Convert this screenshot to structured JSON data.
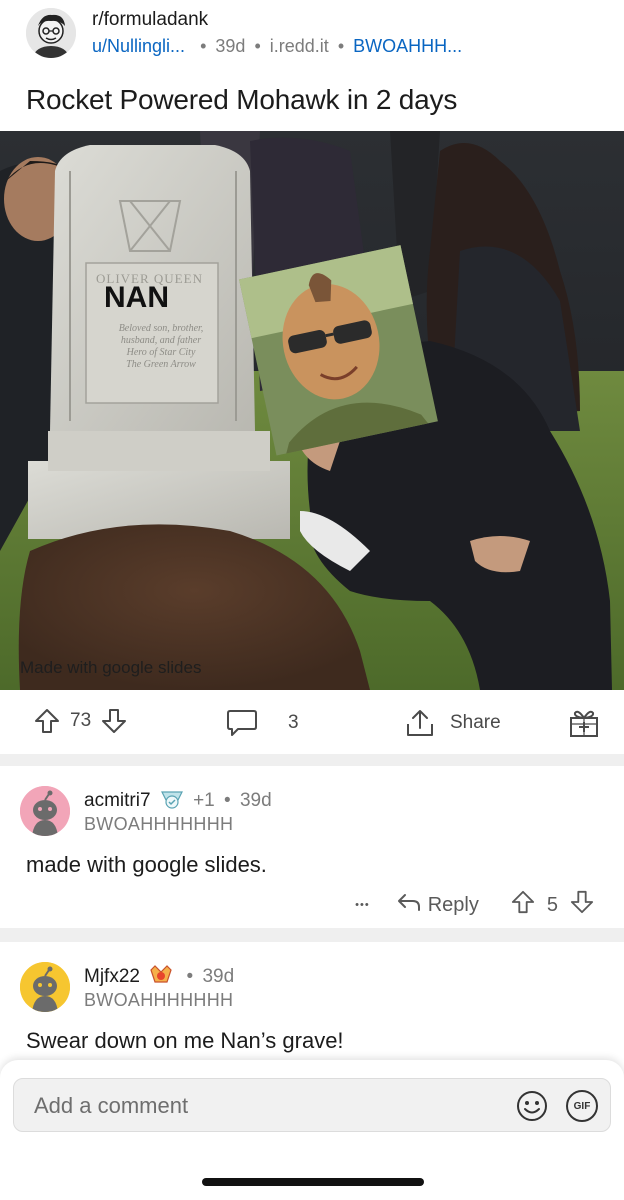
{
  "header": {
    "subreddit": "r/formuladank",
    "username": "u/Nullingli...",
    "age": "39d",
    "domain": "i.redd.it",
    "flair": "BWOAHHH...",
    "separator": "•"
  },
  "post": {
    "title": "Rocket Powered Mohawk in 2 days",
    "image": {
      "headstone_text": "NAN",
      "headstone_faint_name": "OLIVER QUEEN",
      "headstone_epitaph": [
        "Beloved son, brother,",
        "husband, and father",
        "Hero of Star City",
        "The Green Arrow"
      ],
      "caption": "Made with google slides"
    }
  },
  "actions": {
    "votes": "73",
    "comments": "3",
    "share_label": "Share"
  },
  "comments": [
    {
      "username": "acmitri7",
      "award_count": "+1",
      "age": "39d",
      "flair": "BWOAHHHHHHH",
      "body": "made with google slides.",
      "more": "•••",
      "reply_label": "Reply",
      "votes": "5",
      "avatar_color": "#f2a5b8"
    },
    {
      "username": "Mjfx22",
      "age": "39d",
      "flair": "BWOAHHHHHHH",
      "body": "Swear down on me Nan’s grave!",
      "avatar_color": "#f6c630"
    }
  ],
  "comment_box": {
    "placeholder": "Add a comment",
    "gif_label": "GIF"
  },
  "colors": {
    "link_blue": "#0a66c2",
    "band_gray": "#efefef"
  }
}
